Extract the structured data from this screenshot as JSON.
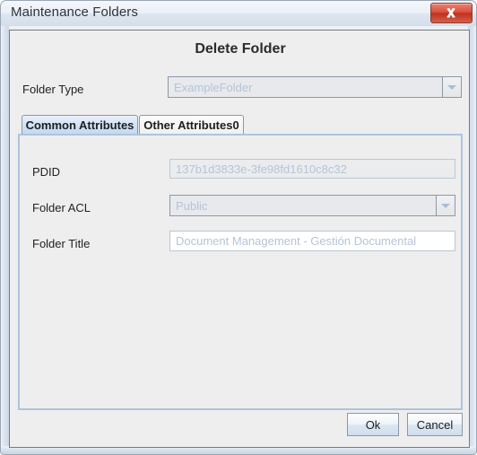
{
  "window": {
    "title": "Maintenance Folders",
    "close_icon": "close-x-icon",
    "accent_color": "#c0301c",
    "panel_background": "#eeeeee"
  },
  "heading": "Delete Folder",
  "folder_type": {
    "label": "Folder Type",
    "value": "ExampleFolder",
    "enabled": "false",
    "arrow_icon": "chevron-down-icon"
  },
  "tabs": [
    {
      "label": "Common Attributes",
      "selected": "true"
    },
    {
      "label": "Other Attributes0",
      "selected": "false"
    }
  ],
  "fields": [
    {
      "label": "PDID",
      "value": "137b1d3833e-3fe98fd1610c8c32",
      "type": "text",
      "enabled": "false"
    },
    {
      "label": "Folder ACL",
      "value": "Public",
      "type": "combo",
      "enabled": "false",
      "arrow_icon": "chevron-down-icon"
    },
    {
      "label": "Folder Title",
      "value": "Document Management -  Gestión Documental",
      "type": "text",
      "enabled": "true"
    }
  ],
  "buttons": {
    "ok": "Ok",
    "cancel": "Cancel"
  }
}
